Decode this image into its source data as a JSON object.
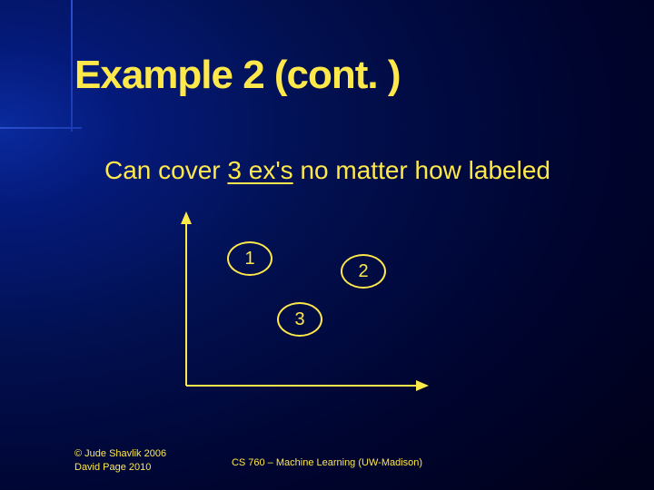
{
  "title": "Example 2 (cont. )",
  "subtitle_pre": "Can cover ",
  "subtitle_underlined": "3 ex's",
  "subtitle_post": " no matter how labeled",
  "points": {
    "p1": "1",
    "p2": "2",
    "p3": "3"
  },
  "footer": {
    "copyright_line1": "© Jude Shavlik 2006",
    "copyright_line2": "David Page 2010",
    "course": "CS 760 – Machine Learning (UW-Madison)"
  }
}
